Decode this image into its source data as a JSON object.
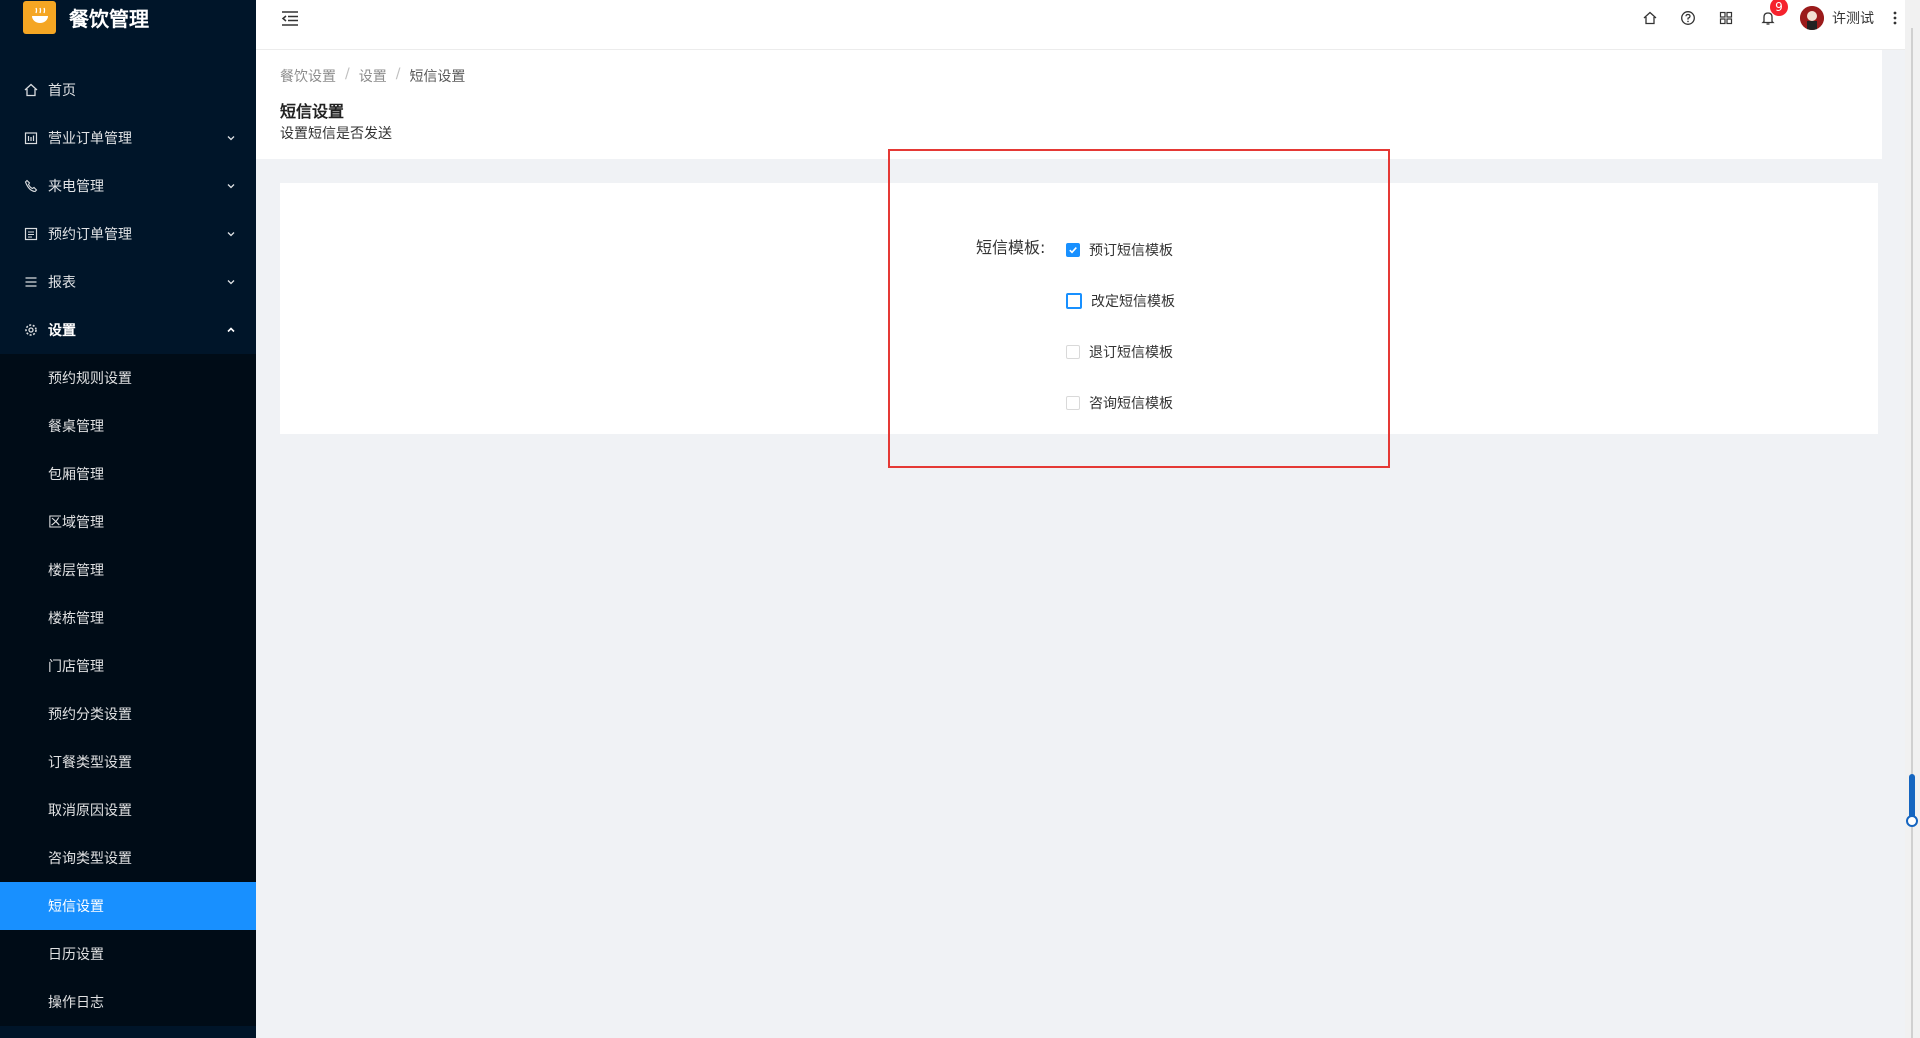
{
  "app": {
    "title": "餐饮管理"
  },
  "sidebar": {
    "items": [
      {
        "label": "首页",
        "icon": "home-icon"
      },
      {
        "label": "营业订单管理",
        "icon": "calendar-icon"
      },
      {
        "label": "来电管理",
        "icon": "phone-icon"
      },
      {
        "label": "预约订单管理",
        "icon": "list-icon"
      },
      {
        "label": "报表",
        "icon": "menu-icon"
      },
      {
        "label": "设置",
        "icon": "gear-icon"
      }
    ],
    "settings_sub": [
      "预约规则设置",
      "餐桌管理",
      "包厢管理",
      "区域管理",
      "楼层管理",
      "楼栋管理",
      "门店管理",
      "预约分类设置",
      "订餐类型设置",
      "取消原因设置",
      "咨询类型设置",
      "短信设置",
      "日历设置",
      "操作日志"
    ],
    "active_sub": "短信设置"
  },
  "header": {
    "notification_count": "9",
    "username": "许测试"
  },
  "breadcrumb": [
    "餐饮设置",
    "设置",
    "短信设置"
  ],
  "page": {
    "title": "短信设置",
    "description": "设置短信是否发送"
  },
  "form": {
    "label": "短信模板:",
    "options": [
      {
        "label": "预订短信模板",
        "checked": true
      },
      {
        "label": "改定短信模板",
        "checked": false
      },
      {
        "label": "退订短信模板",
        "checked": false
      },
      {
        "label": "咨询短信模板",
        "checked": false
      }
    ]
  },
  "colors": {
    "primary": "#1890ff",
    "sidebar": "#001529",
    "highlight": "#e53935"
  }
}
